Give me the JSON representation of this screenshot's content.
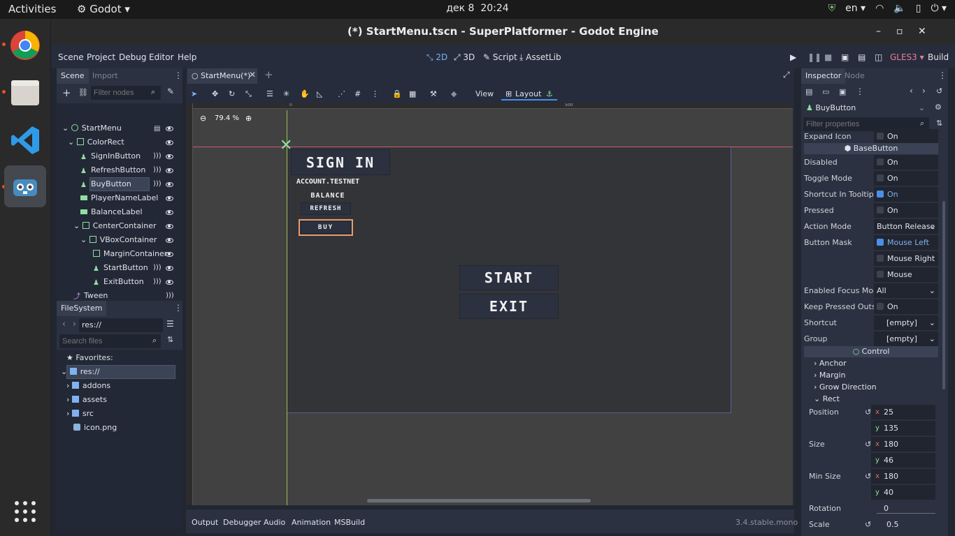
{
  "os": {
    "activities": "Activities",
    "app_menu": "Godot",
    "clock_date": "дек 8",
    "clock_time": "20:24",
    "lang": "en"
  },
  "window": {
    "title": "(*) StartMenu.tscn - SuperPlatformer - Godot Engine"
  },
  "menubar": {
    "items": [
      "Scene",
      "Project",
      "Debug",
      "Editor",
      "Help"
    ],
    "workspaces": [
      "2D",
      "3D",
      "Script",
      "AssetLib"
    ],
    "renderer": "GLES3",
    "build": "Build"
  },
  "scene_dock": {
    "tab_scene": "Scene",
    "tab_import": "Import",
    "filter_placeholder": "Filter nodes",
    "nodes": [
      "StartMenu",
      "ColorRect",
      "SignInButton",
      "RefreshButton",
      "BuyButton",
      "PlayerNameLabel",
      "BalanceLabel",
      "CenterContainer",
      "VBoxContainer",
      "MarginContainer",
      "StartButton",
      "ExitButton",
      "Tween"
    ]
  },
  "filesystem": {
    "tab": "FileSystem",
    "path": "res://",
    "search_placeholder": "Search files",
    "favorites": "Favorites:",
    "root": "res://",
    "items": [
      "addons",
      "assets",
      "src",
      "icon.png"
    ]
  },
  "editor": {
    "tab": "StartMenu(*)",
    "zoom": "79.4 %",
    "view": "View",
    "layout": "Layout",
    "ruler_0": "0",
    "ruler_500": "500",
    "game": {
      "sign_in": "SIGN IN",
      "account": "ACCOUNT.TESTNET",
      "balance": "BALANCE",
      "refresh": "REFRESH",
      "buy": "BUY",
      "start": "START",
      "exit": "EXIT"
    }
  },
  "bottom": {
    "tabs": [
      "Output",
      "Debugger",
      "Audio",
      "Animation",
      "MSBuild"
    ],
    "version": "3.4.stable.mono"
  },
  "inspector": {
    "tab_inspector": "Inspector",
    "tab_node": "Node",
    "node": "BuyButton",
    "filter_placeholder": "Filter properties",
    "expand_icon": "Expand Icon",
    "on": "On",
    "section_basebutton": "BaseButton",
    "disabled": "Disabled",
    "toggle_mode": "Toggle Mode",
    "shortcut_tooltip": "Shortcut In Tooltip",
    "pressed": "Pressed",
    "action_mode": "Action Mode",
    "action_mode_val": "Button Release",
    "button_mask": "Button Mask",
    "mouse_left": "Mouse Left",
    "mouse_right": "Mouse Right",
    "mouse_middle": "Mouse Middle",
    "focus_mode": "Enabled Focus Mod",
    "focus_mode_val": "All",
    "keep_pressed": "Keep Pressed Outs",
    "shortcut": "Shortcut",
    "shortcut_val": "[empty]",
    "group": "Group",
    "group_val": "[empty]",
    "section_control": "Control",
    "anchor": "Anchor",
    "margin": "Margin",
    "grow": "Grow Direction",
    "rect": "Rect",
    "position": "Position",
    "pos_x": "25",
    "pos_y": "135",
    "size": "Size",
    "size_x": "180",
    "size_y": "46",
    "min_size": "Min Size",
    "min_x": "180",
    "min_y": "40",
    "rotation": "Rotation",
    "rotation_val": "0",
    "scale": "Scale",
    "scale_val": "0.5",
    "x": "x",
    "y": "y"
  }
}
